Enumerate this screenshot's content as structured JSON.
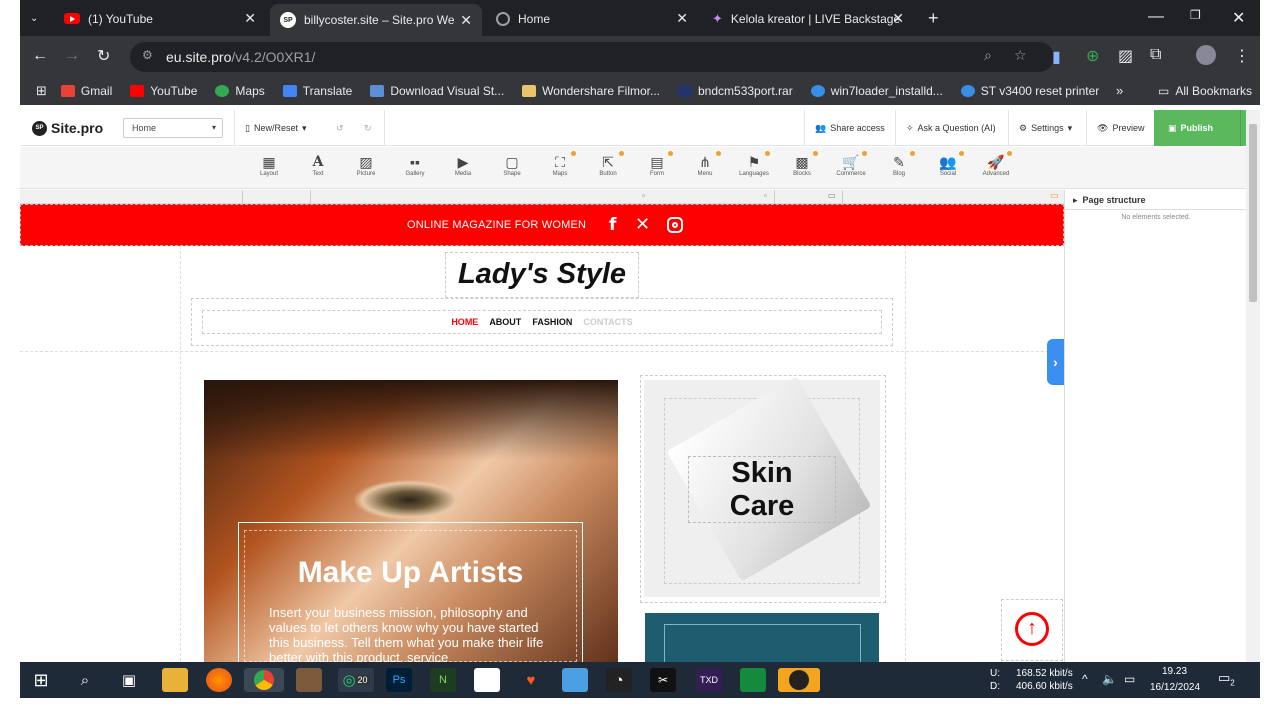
{
  "browser": {
    "tabs": [
      {
        "label": "(1) YouTube",
        "icon": "youtube-icon"
      },
      {
        "label": "billycoster.site – Site.pro Websit",
        "icon": "sitepro-icon"
      },
      {
        "label": "Home",
        "icon": "globe-icon"
      },
      {
        "label": "Kelola kreator | LIVE Backstage",
        "icon": "sparkle-icon"
      }
    ],
    "url_host": "eu.site.pro",
    "url_path": "/v4.2/O0XR1/",
    "bookmarks": [
      "Gmail",
      "YouTube",
      "Maps",
      "Translate",
      "Download Visual St...",
      "Wondershare Filmor...",
      "bndcm533port.rar",
      "win7loader_installd...",
      "ST v3400 reset printer"
    ],
    "all_bookmarks": "All Bookmarks"
  },
  "editor": {
    "brand": "Site.pro",
    "logo_mark": "SP",
    "page_selector": "Home",
    "new_reset": "New/Reset",
    "share": "Share access",
    "ask": "Ask a Question (AI)",
    "settings": "Settings",
    "preview": "Preview",
    "publish": "Publish",
    "widgets": [
      "Layout",
      "Text",
      "Picture",
      "Gallery",
      "Media",
      "Shape",
      "Maps",
      "Button",
      "Form",
      "Menu",
      "Languages",
      "Blocks",
      "Commerce",
      "Blog",
      "Social",
      "Advanced"
    ],
    "page_structure": "Page structure",
    "no_selection": "No elements selected."
  },
  "site": {
    "topbar": "ONLINE MAGAZINE FOR WOMEN",
    "title": "Lady's Style",
    "nav": [
      "HOME",
      "ABOUT",
      "FASHION",
      "CONTACTS"
    ],
    "hero_title": "Make Up Artists",
    "hero_body": "Insert your business mission, philosophy and values to let others know why you have started this business. Tell them what you make their life better with this product, service",
    "card_title_1": "Skin",
    "card_title_2": "Care",
    "accent": "#ff0000"
  },
  "taskbar": {
    "net_up": "168.52 kbit/s",
    "net_down": "406.60 kbit/s",
    "up_label": "U:",
    "down_label": "D:",
    "time": "19.23",
    "date": "16/12/2024",
    "whatsapp_badge": "20",
    "notif_count": "2"
  }
}
